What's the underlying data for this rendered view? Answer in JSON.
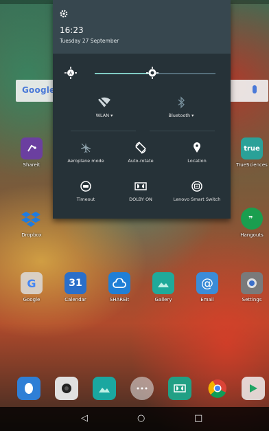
{
  "colors": {
    "panel": "#263238",
    "panel_header": "#37474f",
    "accent": "#80cbc4",
    "nav_bar": "#000000"
  },
  "quick_settings": {
    "time": "16:23",
    "date": "Tuesday 27 September",
    "brightness_level": 0.48,
    "tiles_row1": [
      {
        "label": "WLAN",
        "icon": "wifi-off-icon",
        "dropdown": true
      },
      {
        "label": "Bluetooth",
        "icon": "bluetooth-off-icon",
        "dropdown": true
      }
    ],
    "tiles_row2": [
      {
        "label": "Aeroplane mode",
        "icon": "airplane-icon"
      },
      {
        "label": "Auto-rotate",
        "icon": "auto-rotate-icon"
      },
      {
        "label": "Location",
        "icon": "location-pin-icon"
      }
    ],
    "tiles_row3": [
      {
        "label": "Timeout",
        "icon": "timeout-icon"
      },
      {
        "label": "DOLBY ON",
        "icon": "dolby-icon"
      },
      {
        "label": "Lenovo Smart Switch",
        "icon": "smart-switch-icon"
      }
    ]
  },
  "home": {
    "search_logo": "Google",
    "apps_row1": [
      {
        "label": "Shareit",
        "icon": "shareit-icon",
        "color": "#6b3fa0"
      },
      {
        "label": "TrueSciences",
        "icon": "true-app-icon",
        "color": "#2aa198",
        "text": "true"
      }
    ],
    "apps_row2": [
      {
        "label": "Dropbox",
        "icon": "dropbox-icon",
        "color": "#1f7ce0"
      },
      {
        "label": "Hangouts",
        "icon": "hangouts-icon",
        "color": "#1a9e4f"
      }
    ],
    "apps_row3": [
      {
        "label": "Google",
        "icon": "google-folder-icon",
        "color": "#d0d0d0"
      },
      {
        "label": "Calendar",
        "icon": "calendar-icon",
        "color": "#2a6fc9",
        "text": "31"
      },
      {
        "label": "SHAREit",
        "icon": "cloud-icon",
        "color": "#1f7fd6"
      },
      {
        "label": "Gallery",
        "icon": "gallery-icon",
        "color": "#1faa9a"
      },
      {
        "label": "Email",
        "icon": "email-icon",
        "color": "#3b8cd8",
        "text": "@"
      },
      {
        "label": "Settings",
        "icon": "settings-icon",
        "color": "#7a7a7a"
      }
    ],
    "dock": [
      {
        "icon": "contacts-icon",
        "color": "#2f7fd6"
      },
      {
        "icon": "camera-icon",
        "color": "#e0e0e0"
      },
      {
        "icon": "photos-icon",
        "color": "#1aa7a0"
      },
      {
        "icon": "app-drawer-icon",
        "color": "#d9d9d9"
      },
      {
        "icon": "dolby-app-icon",
        "color": "#21a085"
      },
      {
        "icon": "chrome-icon",
        "color": "#e7e7e7"
      },
      {
        "icon": "play-store-icon",
        "color": "#f0f0f0"
      }
    ]
  },
  "nav": {
    "back": "◁",
    "home": "○",
    "recents": "□"
  }
}
